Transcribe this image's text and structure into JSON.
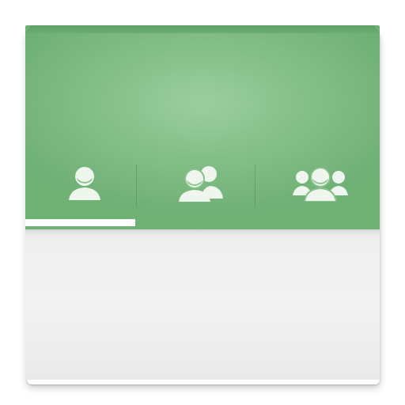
{
  "app": {
    "colors": {
      "header_green": "#86c08a",
      "header_highlight": "#9ccf9f",
      "icon_fill": "#eef6ee",
      "indicator": "#ffffff",
      "content_bg": "#f0f0f0"
    }
  },
  "tabs": [
    {
      "icon": "person-icon",
      "selected": true
    },
    {
      "icon": "two-people-icon",
      "selected": false
    },
    {
      "icon": "group-icon",
      "selected": false
    }
  ],
  "indicator": {
    "selected_index": 0
  }
}
